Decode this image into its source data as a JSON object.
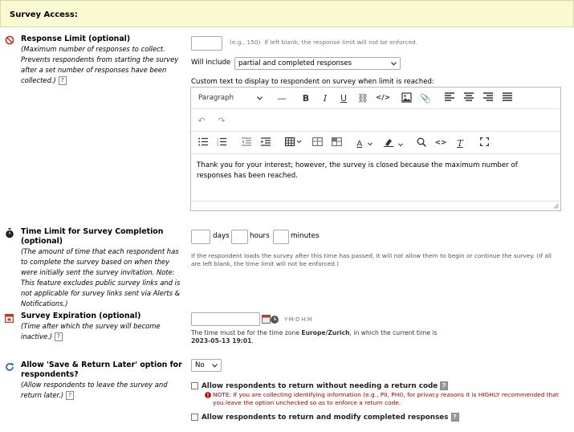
{
  "section_title": "Survey Access:",
  "response_limit": {
    "title": "Response Limit (optional)",
    "description": "(Maximum number of responses to collect. Prevents respondents from starting the survey after a set number of responses have been collected.)",
    "input_value": "",
    "hint_eg": "(e.g., 150)",
    "hint_text": "If left blank, the response limit will not be enforced.",
    "will_include_label": "Will include",
    "will_include_value": "partial and completed responses",
    "custom_text_label": "Custom text to display to respondent on survey when limit is reached:",
    "editor": {
      "block_format": "Paragraph",
      "content": "Thank you for your interest; however, the survey is closed because the maximum number of responses has been reached."
    }
  },
  "time_limit": {
    "title": "Time Limit for Survey Completion (optional)",
    "description": "(The amount of time that each respondent has to complete the survey based on when they were initially sent the survey invitation. Note: This feature excludes public survey links and is not applicable for survey links sent via Alerts & Notifications.)",
    "days_label": "days",
    "hours_label": "hours",
    "minutes_label": "minutes",
    "hint": "If the respondent loads the survey after this time has passed, it will not allow them to begin or continue the survey. (If all are left blank, the time limit will not be enforced.)"
  },
  "expiration": {
    "title": "Survey Expiration (optional)",
    "description": "(Time after which the survey will become inactive.)",
    "format": "Y-M-D H:M",
    "tz_prefix": "The time must be for the time zone",
    "tz_name": "Europe/Zurich",
    "tz_mid": ", in which the current time is",
    "current_time": "2023-05-13 19:01",
    "period": "."
  },
  "save_return": {
    "title": "Allow 'Save & Return Later' option for respondents?",
    "description": "(Allow respondents to leave the survey and return later.)",
    "select_value": "No",
    "option1": "Allow respondents to return without needing a return code",
    "note": "NOTE: If you are collecting identifying information (e.g., PII, PHI), for privacy reasons it is HIGHLY recommended that you leave the option unchecked so as to enforce a return code.",
    "option2": "Allow respondents to return and modify completed responses"
  },
  "colors": {
    "header_bg": "#fafad2",
    "icon_red": "#c0392b",
    "icon_blue": "#2a6fb5",
    "note_red": "#b00000"
  }
}
